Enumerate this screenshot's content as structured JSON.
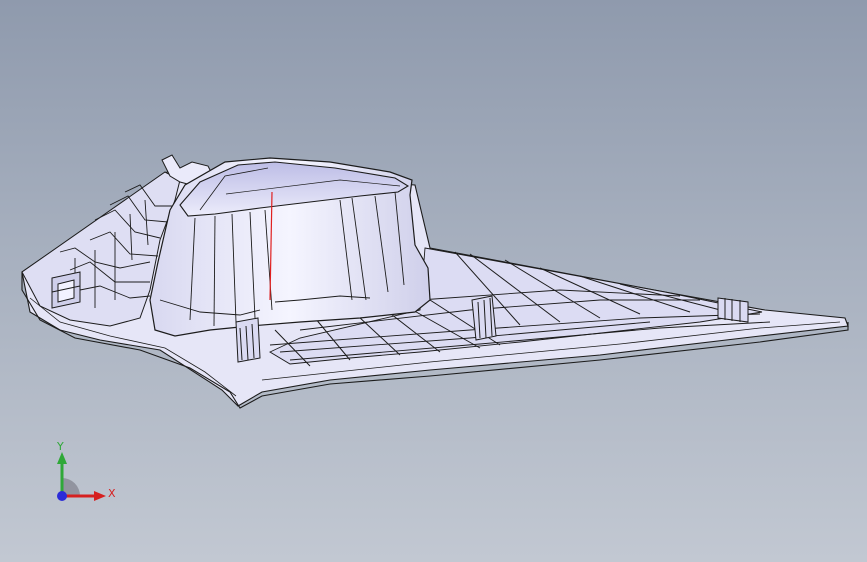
{
  "viewport": {
    "background_top": "#8f9aad",
    "background_bottom": "#c2c8d2",
    "model_fill": "#eeeefa",
    "model_shade": "#c9c9e8",
    "edge_color": "#1a1a1a"
  },
  "triad": {
    "x_label": "X",
    "y_label": "Y",
    "x_color": "#d62020",
    "y_color": "#2fa838",
    "z_color": "#2b2bd8"
  }
}
